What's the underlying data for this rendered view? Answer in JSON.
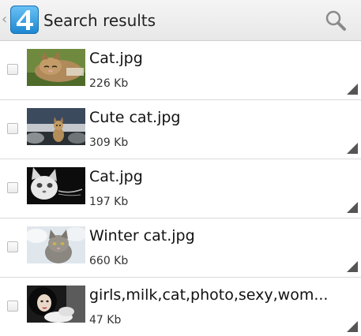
{
  "header": {
    "title": "Search results",
    "back_icon": "back-chevron-icon",
    "logo_icon": "app-logo-icon",
    "search_icon": "search-icon"
  },
  "files": [
    {
      "name": "Cat.jpg",
      "size": "226 Kb",
      "checked": false,
      "thumbnail": "cat lying on grass"
    },
    {
      "name": "Cute cat.jpg",
      "size": "309 Kb",
      "checked": false,
      "thumbnail": "kitten on shore at sunset"
    },
    {
      "name": "Cat.jpg",
      "size": "197 Kb",
      "checked": false,
      "thumbnail": "black and white cat face"
    },
    {
      "name": "Winter cat.jpg",
      "size": "660 Kb",
      "checked": false,
      "thumbnail": "tabby cat in snow"
    },
    {
      "name": "girls,milk,cat,photo,sexy,wom...",
      "size": "47 Kb",
      "checked": false,
      "thumbnail": "dark-haired woman with cat"
    }
  ],
  "colors": {
    "actionbar_bg": "#ececec",
    "divider": "#d9d9d9",
    "logo_blue": "#1c86d2",
    "text": "#111111"
  }
}
